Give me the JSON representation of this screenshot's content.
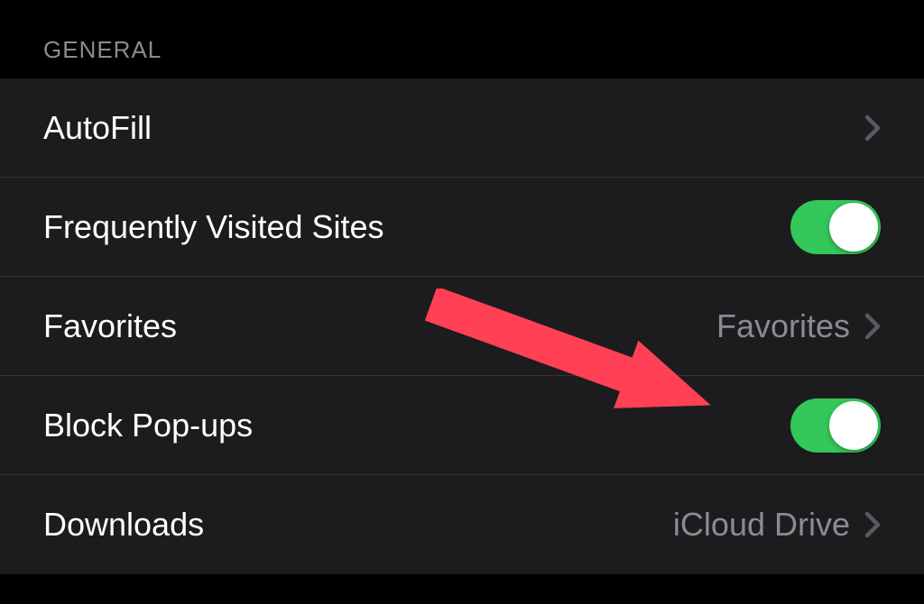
{
  "section": {
    "header": "GENERAL"
  },
  "rows": {
    "autofill": {
      "label": "AutoFill",
      "type": "navigation"
    },
    "frequently_visited": {
      "label": "Frequently Visited Sites",
      "type": "toggle",
      "on": true
    },
    "favorites": {
      "label": "Favorites",
      "value": "Favorites",
      "type": "navigation"
    },
    "block_popups": {
      "label": "Block Pop-ups",
      "type": "toggle",
      "on": true
    },
    "downloads": {
      "label": "Downloads",
      "value": "iCloud Drive",
      "type": "navigation"
    }
  },
  "annotation": {
    "arrow_color": "#ff4055",
    "target": "block_popups_toggle"
  }
}
